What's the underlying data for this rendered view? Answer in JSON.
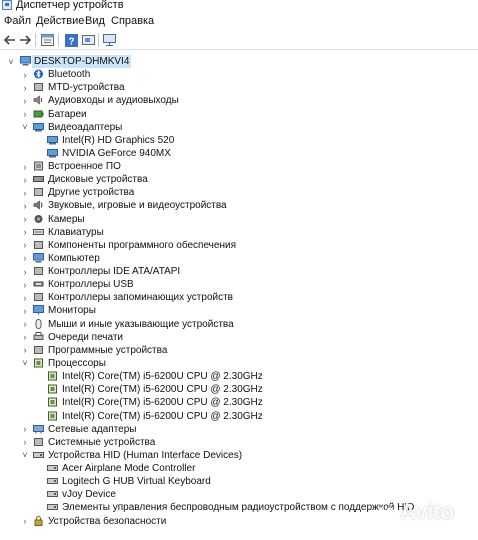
{
  "window": {
    "title": "Диспетчер устройств"
  },
  "menu": [
    {
      "label": "Файл"
    },
    {
      "label": "Действие"
    },
    {
      "label": "Вид"
    },
    {
      "label": "Справка"
    }
  ],
  "toolbar": {
    "buttons": [
      {
        "icon": "back-arrow-icon"
      },
      {
        "icon": "forward-arrow-icon"
      },
      {
        "icon": "properties-icon"
      },
      {
        "icon": "help-icon"
      },
      {
        "icon": "update-driver-icon"
      },
      {
        "icon": "scan-hardware-icon"
      }
    ]
  },
  "tree": {
    "root": "DESKTOP-DHMKVI4",
    "nodes": [
      {
        "label": "Bluetooth",
        "icon": "bluetooth-icon",
        "expanded": false
      },
      {
        "label": "MTD-устройства",
        "icon": "mtd-device-icon",
        "expanded": false
      },
      {
        "label": "Аудиовходы и аудиовыходы",
        "icon": "audio-io-icon",
        "expanded": false
      },
      {
        "label": "Батареи",
        "icon": "battery-icon",
        "expanded": false
      },
      {
        "label": "Видеоадаптеры",
        "icon": "display-adapter-icon",
        "expanded": true,
        "children": [
          {
            "label": "Intel(R) HD Graphics 520"
          },
          {
            "label": "NVIDIA GeForce 940MX"
          }
        ]
      },
      {
        "label": "Встроенное ПО",
        "icon": "firmware-icon",
        "expanded": false
      },
      {
        "label": "Дисковые устройства",
        "icon": "disk-drive-icon",
        "expanded": false
      },
      {
        "label": "Другие устройства",
        "icon": "other-devices-icon",
        "expanded": false
      },
      {
        "label": "Звуковые, игровые и видеоустройства",
        "icon": "sound-icon",
        "expanded": false
      },
      {
        "label": "Камеры",
        "icon": "camera-icon",
        "expanded": false
      },
      {
        "label": "Клавиатуры",
        "icon": "keyboard-icon",
        "expanded": false
      },
      {
        "label": "Компоненты программного обеспечения",
        "icon": "software-component-icon",
        "expanded": false
      },
      {
        "label": "Компьютер",
        "icon": "computer-icon",
        "expanded": false
      },
      {
        "label": "Контроллеры IDE ATA/ATAPI",
        "icon": "ide-controller-icon",
        "expanded": false
      },
      {
        "label": "Контроллеры USB",
        "icon": "usb-controller-icon",
        "expanded": false
      },
      {
        "label": "Контроллеры запоминающих устройств",
        "icon": "storage-controller-icon",
        "expanded": false
      },
      {
        "label": "Мониторы",
        "icon": "monitor-icon",
        "expanded": false
      },
      {
        "label": "Мыши и иные указывающие устройства",
        "icon": "mouse-icon",
        "expanded": false
      },
      {
        "label": "Очереди печати",
        "icon": "print-queue-icon",
        "expanded": false
      },
      {
        "label": "Программные устройства",
        "icon": "software-device-icon",
        "expanded": false
      },
      {
        "label": "Процессоры",
        "icon": "processor-icon",
        "expanded": true,
        "children": [
          {
            "label": "Intel(R) Core(TM) i5-6200U CPU @ 2.30GHz"
          },
          {
            "label": "Intel(R) Core(TM) i5-6200U CPU @ 2.30GHz"
          },
          {
            "label": "Intel(R) Core(TM) i5-6200U CPU @ 2.30GHz"
          },
          {
            "label": "Intel(R) Core(TM) i5-6200U CPU @ 2.30GHz"
          }
        ]
      },
      {
        "label": "Сетевые адаптеры",
        "icon": "network-adapter-icon",
        "expanded": false
      },
      {
        "label": "Системные устройства",
        "icon": "system-device-icon",
        "expanded": false
      },
      {
        "label": "Устройства HID (Human Interface Devices)",
        "icon": "hid-icon",
        "expanded": true,
        "children": [
          {
            "label": "Acer Airplane Mode Controller"
          },
          {
            "label": "Logitech G HUB Virtual Keyboard"
          },
          {
            "label": "vJoy Device"
          },
          {
            "label": "Элементы управления беспроводным радиоустройством с поддержкой HID"
          }
        ]
      },
      {
        "label": "Устройства безопасности",
        "icon": "security-device-icon",
        "expanded": false
      }
    ]
  },
  "watermark": {
    "text": "Avito"
  }
}
